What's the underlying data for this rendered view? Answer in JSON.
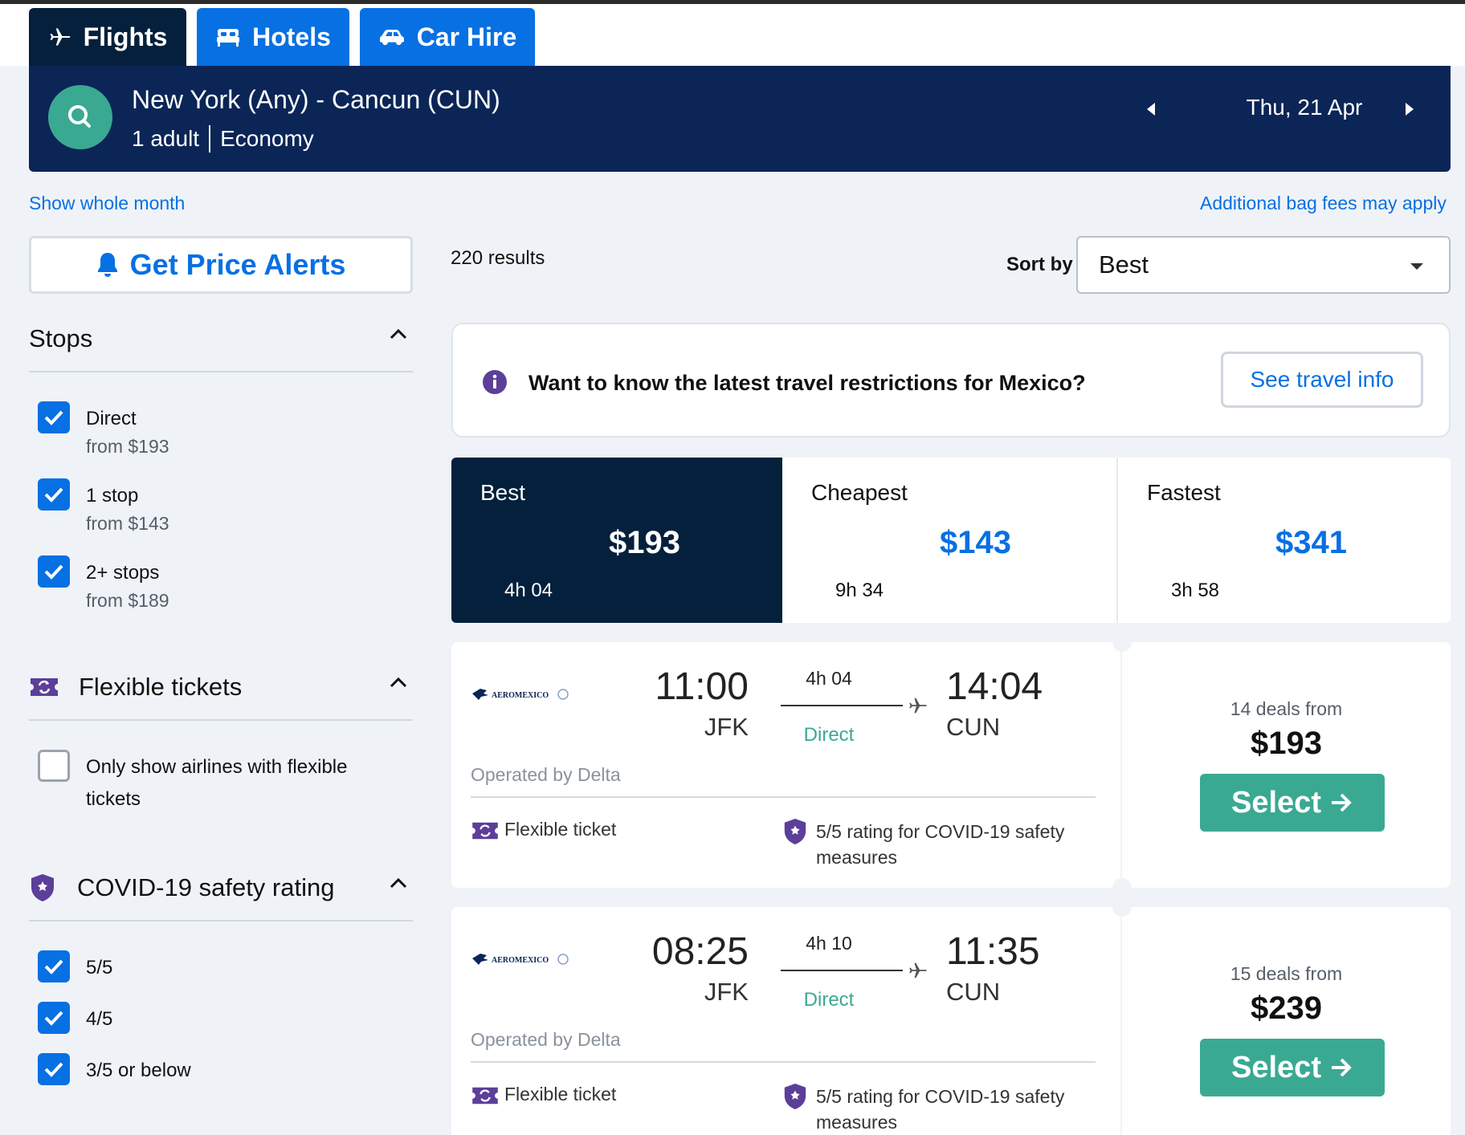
{
  "tabs": [
    {
      "label": "Flights",
      "icon": "plane-icon",
      "active": true
    },
    {
      "label": "Hotels",
      "icon": "bed-icon",
      "active": false
    },
    {
      "label": "Car Hire",
      "icon": "car-icon",
      "active": false
    }
  ],
  "search": {
    "route": "New York (Any) - Cancun (CUN)",
    "travellers": "1 adult",
    "cabin": "Economy",
    "date": "Thu, 21 Apr"
  },
  "links": {
    "whole_month": "Show whole month",
    "bag_fees": "Additional bag fees may apply"
  },
  "price_alerts": "Get Price Alerts",
  "results": {
    "count": "220 results",
    "sort_label": "Sort by",
    "sort_value": "Best"
  },
  "filters": {
    "stops": {
      "title": "Stops",
      "options": [
        {
          "label": "Direct",
          "sub": "from $193",
          "checked": true
        },
        {
          "label": "1 stop",
          "sub": "from $143",
          "checked": true
        },
        {
          "label": "2+ stops",
          "sub": "from $189",
          "checked": true
        }
      ]
    },
    "flexible": {
      "title": "Flexible tickets",
      "option_line1": "Only show airlines with flexible",
      "option_line2": "tickets",
      "checked": false
    },
    "covid": {
      "title": "COVID-19 safety rating",
      "options": [
        {
          "label": "5/5",
          "checked": true
        },
        {
          "label": "4/5",
          "checked": true
        },
        {
          "label": "3/5 or below",
          "checked": true
        }
      ]
    }
  },
  "banner": {
    "message": "Want to know the latest travel restrictions for Mexico?",
    "button": "See travel info"
  },
  "sort_tabs": [
    {
      "name": "Best",
      "price": "$193",
      "duration": "4h 04",
      "active": true
    },
    {
      "name": "Cheapest",
      "price": "$143",
      "duration": "9h 34",
      "active": false
    },
    {
      "name": "Fastest",
      "price": "$341",
      "duration": "3h 58",
      "active": false
    }
  ],
  "flights": [
    {
      "airline": "AEROMEXICO",
      "dep_time": "11:00",
      "dep_airport": "JFK",
      "duration": "4h 04",
      "stops": "Direct",
      "arr_time": "14:04",
      "arr_airport": "CUN",
      "operated": "Operated by Delta",
      "flex": "Flexible ticket",
      "covid": "5/5 rating for COVID-19 safety measures",
      "deals": "14 deals from",
      "price": "$193",
      "select": "Select"
    },
    {
      "airline": "AEROMEXICO",
      "dep_time": "08:25",
      "dep_airport": "JFK",
      "duration": "4h 10",
      "stops": "Direct",
      "arr_time": "11:35",
      "arr_airport": "CUN",
      "operated": "Operated by Delta",
      "flex": "Flexible ticket",
      "covid": "5/5 rating for COVID-19 safety measures",
      "deals": "15 deals from",
      "price": "$239",
      "select": "Select"
    }
  ],
  "colors": {
    "navy": "#05203c",
    "blue": "#0770e3",
    "green": "#3aa992",
    "purple": "#5b3f99"
  }
}
